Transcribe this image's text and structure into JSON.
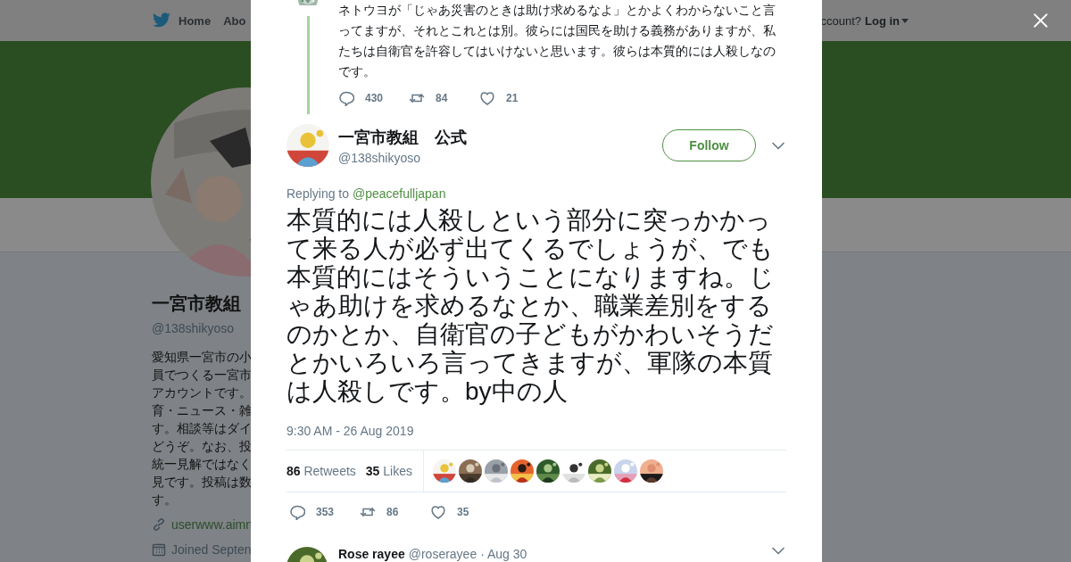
{
  "top_nav": {
    "items": [
      {
        "label": "Home",
        "kind": "home"
      },
      {
        "label": "Abo",
        "kind": "link"
      }
    ],
    "account_prompt": "ccount?",
    "login": "Log in"
  },
  "profile": {
    "name": "一宮市教組",
    "handle": "@138shikyoso",
    "bio": "愛知県一宮市の小員でつくる一宮市アカウントです。育・ニュース・雑す。相談等はダイどうぞ。なお、投統一見解ではなく見です。投稿は数す。",
    "website": "userwww.aimn",
    "joined": "Joined Septen"
  },
  "previous_tweet": {
    "text": "ネトウヨが「じゃあ災害のときは助け求めるなよ」とかよくわからないこと言ってますが、それとこれとは別。彼らには国民を助ける義務がありますが、私たちは自衛官を許容してはいけないと思います。彼らは本質的には人殺しなのです。",
    "actions": [
      {
        "kind": "reply",
        "count": "430"
      },
      {
        "kind": "retweet",
        "count": "84"
      },
      {
        "kind": "like",
        "count": "21"
      }
    ]
  },
  "tweet": {
    "name": "一宮市教組　公式",
    "handle": "@138shikyoso",
    "follow_label": "Follow",
    "replying_label": "Replying to",
    "replying_to": "@peacefulljapan",
    "text": "本質的には人殺しという部分に突っかかって来る人が必ず出てくるでしょうが、でも本質的にはそういうことになりますね。じゃあ助けを求めるなとか、職業差別をするのかとか、自衛官の子どもがかわいそうだとかいろいろ言ってきますが、軍隊の本質は人殺しです。by中の人",
    "timestamp": "9:30 AM - 26 Aug 2019",
    "stats": [
      {
        "count": "86",
        "label": "Retweets"
      },
      {
        "count": "35",
        "label": "Likes"
      }
    ],
    "actions": [
      {
        "kind": "reply",
        "count": "353"
      },
      {
        "kind": "retweet",
        "count": "86"
      },
      {
        "kind": "like",
        "count": "35"
      }
    ]
  },
  "next_tweet": {
    "name": "Rose rayee",
    "handle": "@roserayee",
    "date": "· Aug 30"
  }
}
